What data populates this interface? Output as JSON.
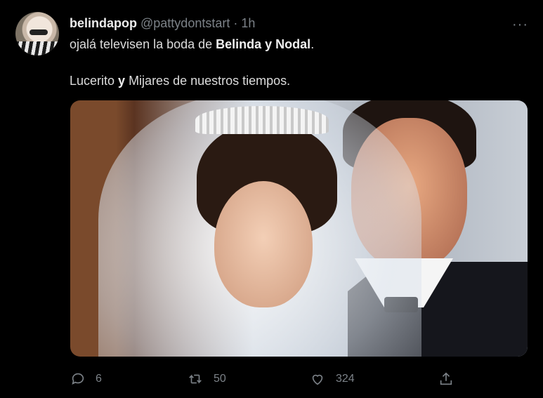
{
  "tweet": {
    "author_name": "belindapop",
    "author_handle": "@pattydontstart",
    "separator": "·",
    "time": "1h",
    "more": "···",
    "line1": {
      "text_a": "ojalá televisen la boda de ",
      "bold": "Belinda y Nodal",
      "text_b": "."
    },
    "line2": {
      "text_a": "Lucerito ",
      "bold": "y",
      "text_b": " Mijares de nuestros tiempos."
    }
  },
  "actions": {
    "reply_count": "6",
    "retweet_count": "50",
    "like_count": "324"
  },
  "colors": {
    "background": "#000000",
    "muted": "#7c8288",
    "text": "#d9d9d9"
  },
  "icons": [
    "reply-icon",
    "retweet-icon",
    "like-icon",
    "share-icon",
    "more-icon"
  ]
}
